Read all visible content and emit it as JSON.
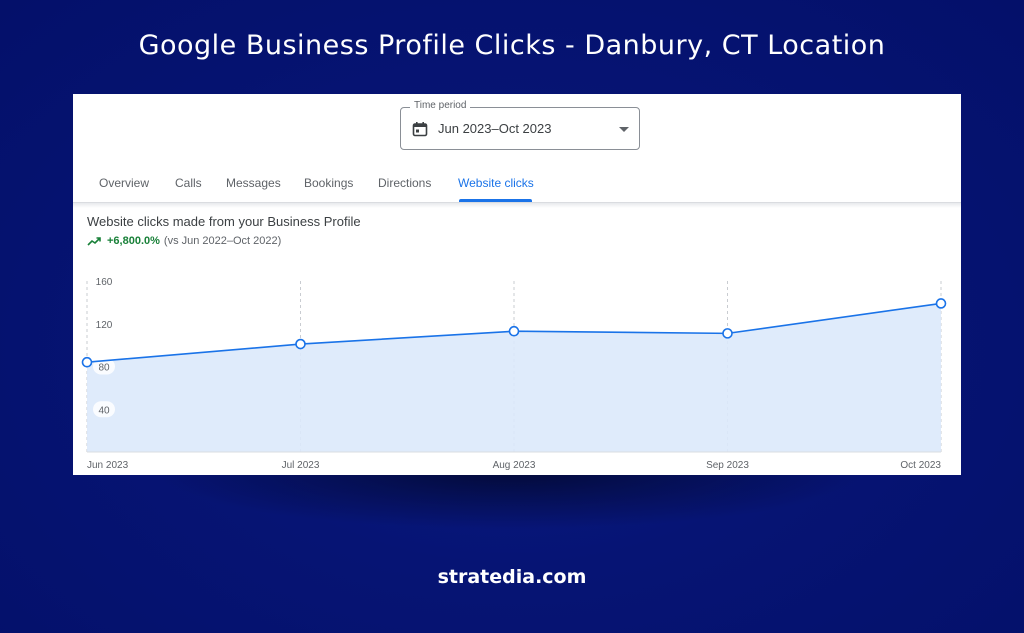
{
  "page": {
    "title": "Google Business Profile Clicks - Danbury, CT Location",
    "brand": "stratedia.com"
  },
  "period": {
    "legend": "Time period",
    "value": "Jun 2023–Oct 2023",
    "icon": "calendar-icon"
  },
  "tabs": [
    {
      "label": "Overview",
      "active": false
    },
    {
      "label": "Calls",
      "active": false
    },
    {
      "label": "Messages",
      "active": false
    },
    {
      "label": "Bookings",
      "active": false
    },
    {
      "label": "Directions",
      "active": false
    },
    {
      "label": "Website clicks",
      "active": true
    }
  ],
  "chart_header": {
    "heading": "Website clicks made from your Business Profile",
    "change": "+6,800.0%",
    "comparison": "(vs Jun 2022–Oct 2022)",
    "trend_icon": "trending-up-icon"
  },
  "colors": {
    "background": "#061474",
    "accent": "#1a73e8",
    "positive": "#188038",
    "area_fill": "#dce9fb"
  },
  "chart_data": {
    "type": "area",
    "x": [
      "Jun 2023",
      "Jul 2023",
      "Aug 2023",
      "Sep 2023",
      "Oct 2023"
    ],
    "series": [
      {
        "values": [
          84,
          101,
          113,
          111,
          139
        ]
      }
    ],
    "yticks": [
      160,
      120,
      80,
      40
    ],
    "ylim": [
      0,
      160
    ],
    "grid": "vertical-dashed"
  }
}
